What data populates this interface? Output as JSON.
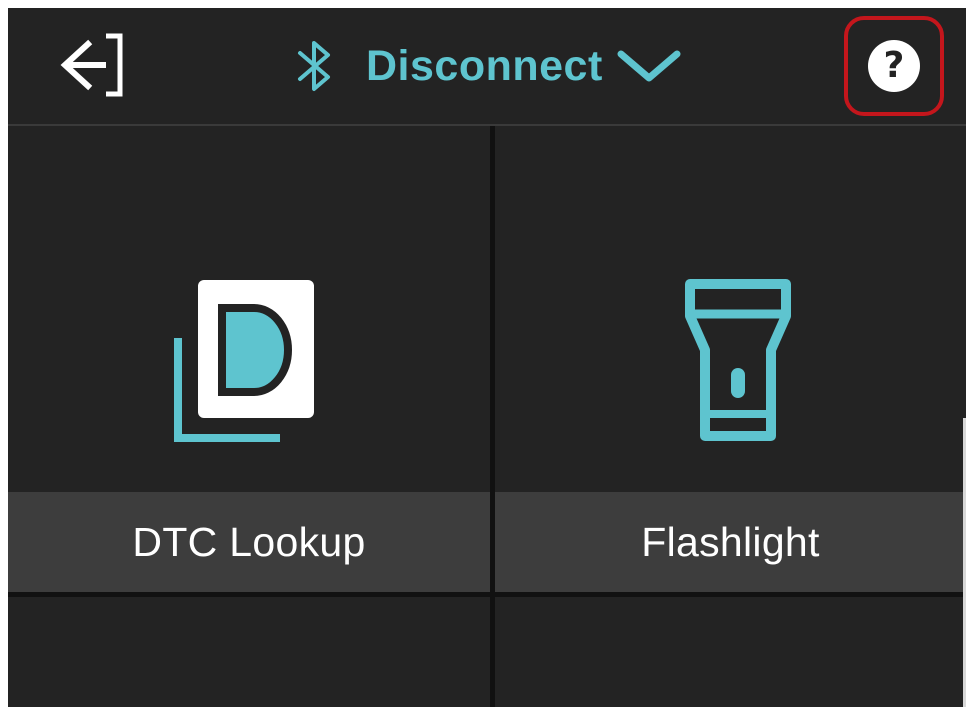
{
  "header": {
    "connection_label": "Disconnect",
    "help_symbol": "?",
    "icons": {
      "exit": "exit-arrow-icon",
      "bluetooth": "bluetooth-icon",
      "chevron": "chevron-down-icon",
      "help": "help-icon"
    }
  },
  "tiles": [
    {
      "label": "DTC Lookup",
      "icon": "dtc-lookup-icon"
    },
    {
      "label": "Flashlight",
      "icon": "flashlight-icon"
    }
  ],
  "colors": {
    "accent": "#5ec4cf",
    "background": "#232323",
    "caption_bar": "#3d3d3d",
    "highlight": "#c4161c",
    "text": "#ffffff"
  }
}
